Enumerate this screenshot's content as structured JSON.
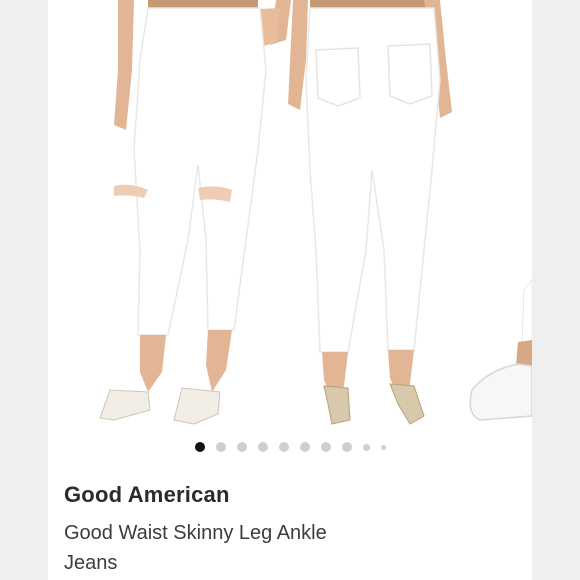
{
  "product": {
    "brand": "Good American",
    "title": "Good Waist Skinny Leg Ankle Jeans"
  },
  "gallery": {
    "image_count": 10,
    "active_index": 0,
    "colors": {
      "background": "#ffffff",
      "denim": "#ffffff",
      "skin": "#e2b595",
      "waistband": "#b9936c",
      "active_dot": "#111111",
      "inactive_dot": "#cfcfcf"
    }
  }
}
